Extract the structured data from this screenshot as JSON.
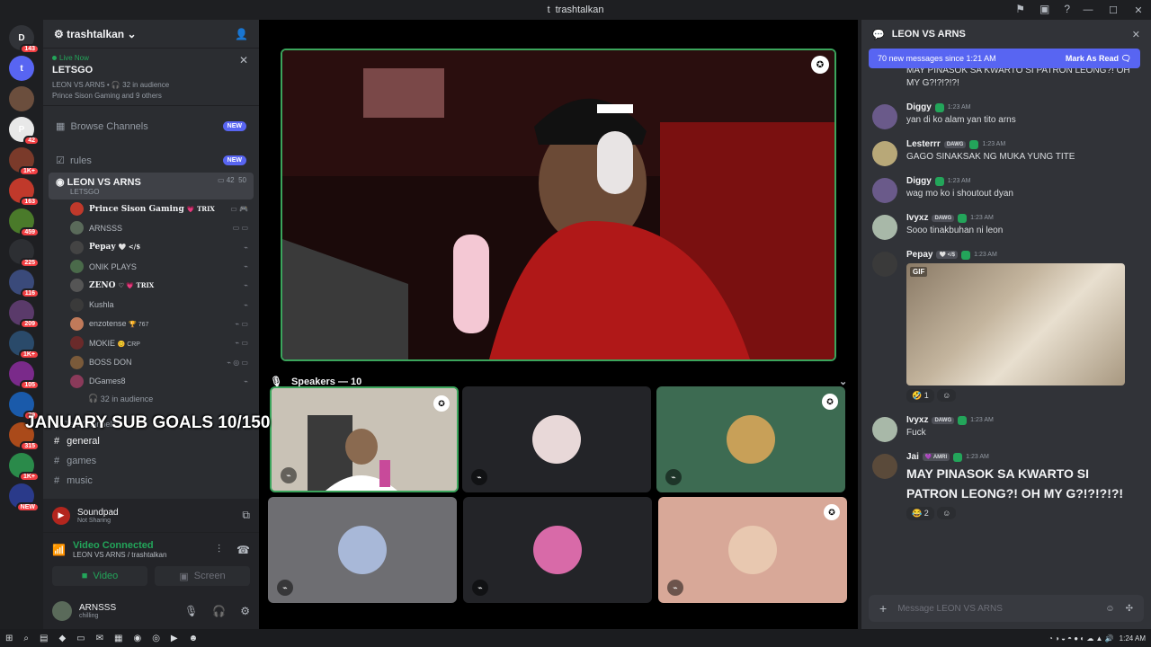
{
  "window": {
    "title": "trashtalkan",
    "controls": [
      "—",
      "☐",
      "✕"
    ]
  },
  "guilds": [
    {
      "label": "143",
      "badge": "143",
      "color": "#313338",
      "glyph": "D"
    },
    {
      "label": "t",
      "badge": "",
      "color": "#5865f2",
      "glyph": "t"
    },
    {
      "label": "",
      "badge": "",
      "color": "#6b4e3d",
      "glyph": ""
    },
    {
      "label": "42",
      "badge": "42",
      "color": "#e8e8e8",
      "glyph": "P"
    },
    {
      "label": "1K+",
      "badge": "1K+",
      "color": "#7a3a2a",
      "glyph": ""
    },
    {
      "label": "163",
      "badge": "163",
      "color": "#c0392b",
      "glyph": ""
    },
    {
      "label": "459",
      "badge": "459",
      "color": "#4a7a2a",
      "glyph": ""
    },
    {
      "label": "225",
      "badge": "225",
      "color": "#2d2f33",
      "glyph": ""
    },
    {
      "label": "116",
      "badge": "116",
      "color": "#3a4a7a",
      "glyph": ""
    },
    {
      "label": "209",
      "badge": "209",
      "color": "#5a3a6a",
      "glyph": ""
    },
    {
      "label": "1K+",
      "badge": "1K+",
      "color": "#2a4a6a",
      "glyph": ""
    },
    {
      "label": "105",
      "badge": "105",
      "color": "#7a2a8a",
      "glyph": ""
    },
    {
      "label": "79",
      "badge": "79",
      "color": "#1a5aaa",
      "glyph": ""
    },
    {
      "label": "315",
      "badge": "315",
      "color": "#aa4a1a",
      "glyph": ""
    },
    {
      "label": "1K+",
      "badge": "1K+",
      "color": "#2a8a4a",
      "glyph": ""
    },
    {
      "label": "NEW",
      "badge": "NEW",
      "color": "#2a3a8a",
      "glyph": ""
    }
  ],
  "server": {
    "name": "trashtalkan"
  },
  "live": {
    "label": "Live Now",
    "title": "LETSGO",
    "meta": "LEON VS ARNS • 🎧 32 in audience",
    "people": "Prince Sison Gaming and 9 others"
  },
  "browse": {
    "label": "Browse Channels",
    "badge": "NEW"
  },
  "rules": {
    "label": "rules",
    "badge": "NEW"
  },
  "voice_channel": {
    "name": "LEON VS ARNS",
    "topic": "LETSGO",
    "count_a": "42",
    "count_b": "50"
  },
  "voice_users": [
    {
      "name": "Prince Sison Gaming",
      "extra": "💗 TRIX",
      "color": "#c0392b",
      "bold": true,
      "icons": "▭ 🎮"
    },
    {
      "name": "ARNSSS",
      "extra": "",
      "color": "#5a6a5a",
      "bold": false,
      "icons": "▭ ▭"
    },
    {
      "name": "Pepay",
      "extra": "🤍 </$",
      "color": "#444",
      "bold": true,
      "icons": "⌁"
    },
    {
      "name": "ONIK PLAYS",
      "extra": "",
      "color": "#4a6a4a",
      "bold": false,
      "icons": "⌁"
    },
    {
      "name": "ZENO",
      "extra": "♡ 💗 TRIX",
      "color": "#555",
      "bold": true,
      "icons": "⌁"
    },
    {
      "name": "Kushla",
      "extra": "",
      "color": "#3a3a3a",
      "bold": false,
      "icons": "⌁"
    },
    {
      "name": "enzotense",
      "extra": "🏆 767",
      "color": "#c07a5a",
      "bold": false,
      "icons": "⌁ ▭"
    },
    {
      "name": "MOKIE",
      "extra": "😊 CRP",
      "color": "#6a2a2a",
      "bold": false,
      "icons": "⌁ ▭"
    },
    {
      "name": "BOSS DON",
      "extra": "",
      "color": "#7a5a3a",
      "bold": false,
      "icons": "⌁ ◎ ▭"
    },
    {
      "name": "DGames8",
      "extra": "",
      "color": "#8a3a5a",
      "bold": false,
      "icons": "⌁"
    }
  ],
  "audience": "32 in audience",
  "overlay": "JANUARY SUB GOALS 10/150",
  "text_category": "Text Channels",
  "text_channels": [
    "general",
    "games",
    "music"
  ],
  "soundpad": {
    "name": "Soundpad",
    "status": "Not Sharing"
  },
  "voice_status": {
    "title": "Video Connected",
    "sub": "LEON VS ARNS / trashtalkan",
    "video": "Video",
    "screen": "Screen"
  },
  "user": {
    "name": "ARNSSS",
    "status": "chilling"
  },
  "speakers": {
    "label": "Speakers — 10"
  },
  "tiles": [
    {
      "color": "#c9c2b6",
      "avatar": "",
      "mic": "⌁",
      "ico": true,
      "video": true
    },
    {
      "color": "#232428",
      "avatar": "#e8d8d8",
      "mic": "⌁",
      "ico": false,
      "video": false
    },
    {
      "color": "#3d6b52",
      "avatar": "#c8a058",
      "mic": "⌁",
      "ico": true,
      "video": false
    },
    {
      "color": "#6e6e72",
      "avatar": "#a8b8d8",
      "mic": "⌁",
      "ico": false,
      "video": false
    },
    {
      "color": "#232428",
      "avatar": "#d86aa8",
      "mic": "⌁",
      "ico": false,
      "video": false
    },
    {
      "color": "#d8a898",
      "avatar": "#e8c8b0",
      "mic": "⌁",
      "ico": true,
      "video": false
    }
  ],
  "chat": {
    "title": "LEON VS ARNS",
    "new_messages": "70 new messages since 1:21 AM",
    "mark_read": "Mark As Read",
    "input_placeholder": "Message LEON VS ARNS",
    "messages": [
      {
        "author": "",
        "tag": "",
        "time": "",
        "text": "MAY PINASOK SA KWARTO SI PATRON LEONG?! OH MY G?!?!?!?!",
        "avatar": "",
        "big": false
      },
      {
        "author": "Diggy",
        "tag": "",
        "time": "1:23 AM",
        "text": "yan di ko alam yan tito arns",
        "avatar": "#6a5a8a",
        "big": false
      },
      {
        "author": "Lesterrr",
        "tag": "DAWG",
        "time": "1:23 AM",
        "text": "GAGO SINAKSAK NG MUKA YUNG TITE",
        "avatar": "#b8a878",
        "big": false
      },
      {
        "author": "Diggy",
        "tag": "",
        "time": "1:23 AM",
        "text": "wag mo ko i shoutout dyan",
        "avatar": "#6a5a8a",
        "big": false
      },
      {
        "author": "Ivyxz",
        "tag": "DAWG",
        "time": "1:23 AM",
        "text": "Sooo tinakbuhan ni leon",
        "avatar": "#a8b8a8",
        "big": false
      },
      {
        "author": "Pepay",
        "tag": "🤍 </$",
        "time": "1:23 AM",
        "text": "",
        "avatar": "#3a3a3a",
        "big": false,
        "gif": true,
        "reaction": "🤣 1"
      },
      {
        "author": "Ivyxz",
        "tag": "DAWG",
        "time": "1:23 AM",
        "text": "Fuck",
        "avatar": "#a8b8a8",
        "big": false
      },
      {
        "author": "Jai",
        "tag": "💜 AMRI",
        "time": "1:23 AM",
        "text": "MAY PINASOK SA KWARTO SI PATRON LEONG?! OH MY G?!?!?!?!",
        "avatar": "#5a4a3a",
        "big": true,
        "reaction": "😂 2"
      }
    ]
  },
  "taskbar": {
    "time": "1:24 AM"
  }
}
